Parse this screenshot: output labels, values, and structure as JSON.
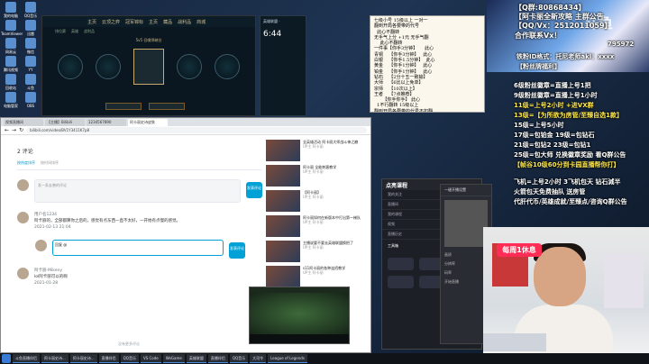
{
  "desktop": {
    "icons": [
      "我的电脑",
      "TeamViewer",
      "网易云",
      "腾讯视频",
      "回收站",
      "电脑管家",
      "QQ音乐",
      "迅雷",
      "微信",
      "YY",
      "斗鱼",
      "OBS"
    ]
  },
  "game_client": {
    "nav": [
      "主页",
      "云顶之弈",
      "冠军锦标",
      "主页",
      "藏品",
      "战利品",
      "商城"
    ],
    "tabs": [
      "排位赛",
      "英雄",
      "战利品"
    ],
    "mode_label": "5v5 召唤师峡谷"
  },
  "side_window": {
    "title": "英雄联盟 ·",
    "time": "6:44"
  },
  "notice": {
    "lines": [
      "七级小号 15级以上 一对一  ",
      "翻到开局各要带的代号",
      "  此心不翻转     ",
      "无手气上分 +1元 无手气翻",
      "    此心不翻转  ",
      "一件事【你手3分钟】     此心",
      "青铜    【你手3分钟】   此心",
      "白银    【你手1.5分钟】  此心",
      "黄金    【你手1分钟】   此心",
      "铂金    【你手1分钟】   此心",
      "钻石    【2分十五一致输】",
      "大师    【6比以上免单】",
      "宗师    【10次以上】",
      "王者    【7点推荐】",
      "      【你手你手】 此心",
      "  1不行翻转 15级以上  ",
      "翻到开局各要带的代号不如翻",
      "  你手2分钟 此心 ",
      "  【100元以上局破大隆门】",
      "阿卡丽 【你手1分钟】   此心",
      "伊泽瑞尔【你手1分钟】   此心",
      "   【你手1分钟】   此心",
      "亚索   【你手1分钟】"
    ]
  },
  "browser": {
    "tabs": [
      "视频直播间",
      "【主播】Bilibili",
      "1234567890",
      "阿卡丽史诗皮肤"
    ],
    "url": "bilibili.com/video/BV1Y3411K7p8",
    "section_title": "2 评论",
    "sort_options": [
      "按热度排序",
      "按时间排序"
    ],
    "comment_placeholder": "发一条友善的评论",
    "send_label": "发表评论",
    "comments": [
      {
        "name": "用户名1234",
        "text": "阿卡丽的，全部都算你之后的，感觉有点东西一直不太好，一开始有点慢的感觉。",
        "time": "2021-02-13 21:04"
      },
      {
        "name": "阿卡丽-Mikeny",
        "text": "lol阿卡丽可以的啊",
        "time": "2021-01-28"
      }
    ],
    "reply_placeholder": "回复 @",
    "footer": "没有更多评论",
    "recommended": [
      {
        "title": "全英雄活动 阿卡丽大师战斗神之巅",
        "up": "UP主 阿卡丽"
      },
      {
        "title": "阿卡丽 全能刺客教学",
        "up": "UP主 阿卡丽"
      },
      {
        "title": "【阿卡丽】",
        "up": "UP主 阿卡丽"
      },
      {
        "title": "阿卡丽如何在新版本中打出第一梯队",
        "up": "UP主 阿卡丽"
      },
      {
        "title": "主播说要不要去英雄联盟换把了",
        "up": "UP主 阿卡丽"
      },
      {
        "title": "s11阿卡丽的各种连招教学",
        "up": "UP主 阿卡丽"
      },
      {
        "title": "阿卡丽刺杀视频大全",
        "up": "UP主 阿卡丽"
      }
    ]
  },
  "app_window": {
    "logo": "点亮课程",
    "items": [
      "我的关注",
      "直播间",
      "我的课程",
      "视频",
      "直播历史"
    ],
    "section": "工具箱"
  },
  "popup": {
    "title": "一键开播设置",
    "options": [
      "画质",
      "分辨率",
      "码率",
      "开始直播"
    ]
  },
  "overlay": {
    "qq_group": "【Q群:80868434】",
    "line2": "【阿卡丽全新攻略 主群公告",
    "line3": "【QQ/Vx：2512011059】",
    "line4": "合作联系Vx！",
    "line5": "795972",
    "line6": "铁粉ID格式：托尼老师akl：xxxx",
    "line7": "【粉丝牌福利】",
    "line8": "6级粉丝徽章=直播上号1把",
    "line9": "9级粉丝徽章=直播上号1小时",
    "line10": "11级=上号2小时 +进VX群",
    "line11": "13级=【为所欲为房管/至臻自选1款】",
    "line12": "15级=上号5小时",
    "line13": "17级=包铂金  19级=包钻石",
    "line14": "21级=包钻2   23级=包钻1",
    "line15": "25级=包大师 兑换徽章奖励 看Q群公告",
    "line16": "【帧谷10级60分到卡园直播帮你打】",
    "line17": "飞机=上号2小时 3飞机包天 钻石減半",
    "line18": "火箭包天免费抽队 送房管",
    "line19": "代肝代币/英雄成就/至臻点/咨询Q群公告",
    "huya": "斗鱼",
    "rest_badge": "每周1休息"
  },
  "taskbar": {
    "items": [
      "斗鱼直播伴侣",
      "阿卡丽史诗...",
      "阿卡丽史诗...",
      "直播伴侣",
      "QQ音乐",
      "VS Code",
      "WeGame",
      "英雄联盟",
      "直播伴侣",
      "QQ音乐",
      "大司令",
      "League of Legends"
    ]
  },
  "colors": {
    "overlay_text": "#ffffff",
    "overlay_yellow": "#ffe94a",
    "bili_blue": "#00a1d6",
    "rest_red": "#ff2d55"
  }
}
